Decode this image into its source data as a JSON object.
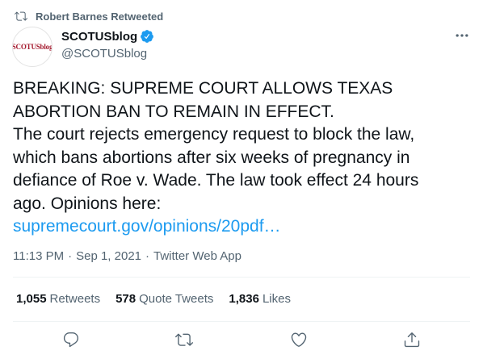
{
  "retweet_context": {
    "text": "Robert Barnes Retweeted",
    "icon": "retweet-icon"
  },
  "author": {
    "display_name": "SCOTUSblog",
    "handle": "@SCOTUSblog",
    "avatar_text": "SCOTUSblog",
    "verified": true
  },
  "tweet": {
    "lines": [
      "BREAKING: SUPREME COURT ALLOWS TEXAS",
      "ABORTION BAN TO REMAIN IN EFFECT.",
      "The court rejects emergency request to block the law,",
      "which bans abortions after six weeks of pregnancy in",
      "defiance of Roe v. Wade. The law took effect 24 hours",
      "ago. Opinions here:"
    ],
    "link_text": "supremecourt.gov/opinions/20pdf…"
  },
  "meta": {
    "time": "11:13 PM",
    "date": "Sep 1, 2021",
    "source": "Twitter Web App",
    "separator": "·"
  },
  "stats": {
    "retweets": {
      "count": "1,055",
      "label": "Retweets"
    },
    "quotes": {
      "count": "578",
      "label": "Quote Tweets"
    },
    "likes": {
      "count": "1,836",
      "label": "Likes"
    }
  },
  "actions": [
    "reply-icon",
    "retweet-icon",
    "like-icon",
    "share-icon"
  ],
  "colors": {
    "link": "#1d9bf0",
    "secondary_text": "#536471",
    "primary_text": "#0f1419",
    "verified": "#1d9bf0",
    "divider": "#eff3f4"
  }
}
